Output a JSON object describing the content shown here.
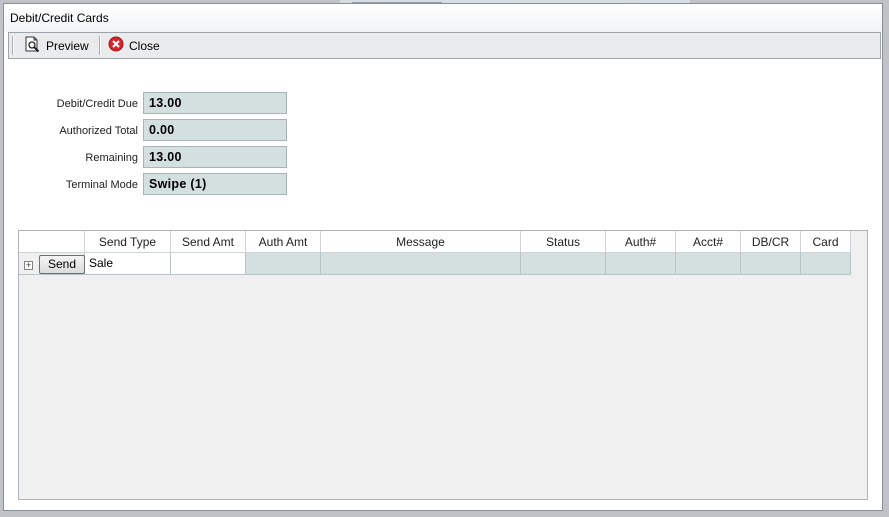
{
  "window": {
    "title": "Debit/Credit Cards"
  },
  "toolbar": {
    "preview_label": "Preview",
    "close_label": "Close"
  },
  "fields": [
    {
      "label": "Debit/Credit Due",
      "value": "13.00"
    },
    {
      "label": "Authorized Total",
      "value": "0.00"
    },
    {
      "label": "Remaining",
      "value": "13.00"
    },
    {
      "label": "Terminal Mode",
      "value": "Swipe (1)"
    }
  ],
  "grid": {
    "columns": [
      "",
      "Send Type",
      "Send Amt",
      "Auth Amt",
      "Message",
      "Status",
      "Auth#",
      "Acct#",
      "DB/CR",
      "Card"
    ],
    "row": {
      "expander": "+",
      "send_button": "Send",
      "send_type": "Sale",
      "send_amt": "",
      "auth_amt": "",
      "message": "",
      "status": "",
      "auth_no": "",
      "acct_no": "",
      "db_cr": "",
      "card": ""
    }
  }
}
